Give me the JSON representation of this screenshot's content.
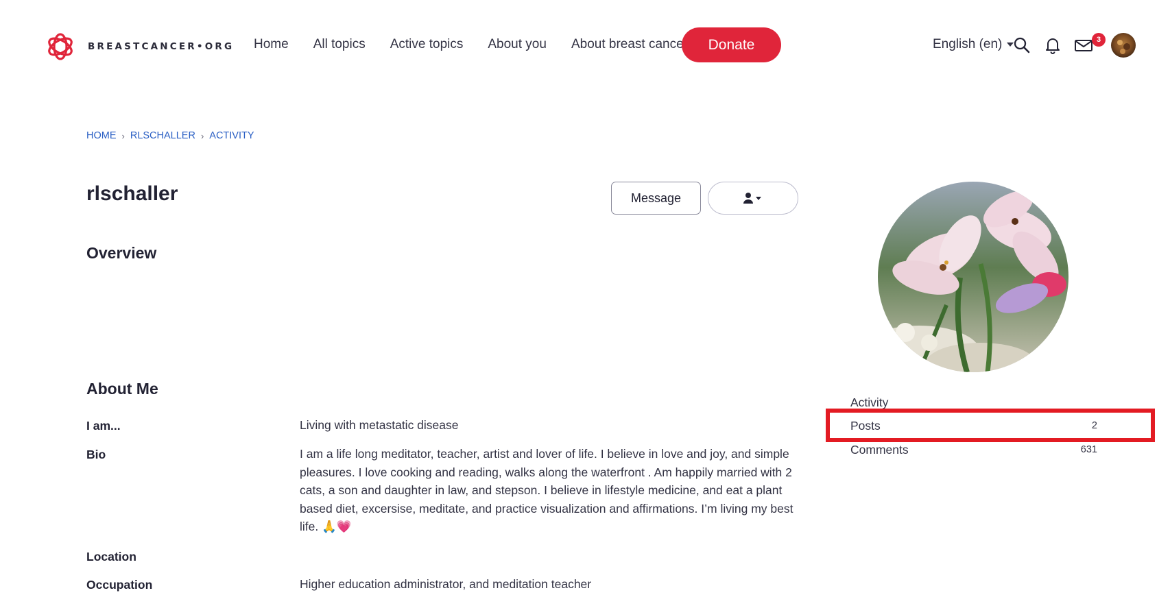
{
  "brand": {
    "name": "BREASTCANCER•ORG"
  },
  "nav": [
    "Home",
    "All topics",
    "Active topics",
    "About you",
    "About breast cancer"
  ],
  "donate_label": "Donate",
  "language": "English (en)",
  "notifications": {
    "messages_badge": "3"
  },
  "breadcrumb": [
    "HOME",
    "RLSCHALLER",
    "ACTIVITY"
  ],
  "profile": {
    "username": "rlschaller",
    "message_button": "Message",
    "overview_title": "Overview",
    "about_title": "About Me",
    "fields": {
      "iam_label": "I am...",
      "iam_value": "Living with metastatic disease",
      "bio_label": "Bio",
      "bio_value": "I am a life long meditator, teacher, artist and lover of life. I believe in love and joy, and simple pleasures. I love cooking and reading, walks along the waterfront . Am happily married with 2 cats, a son and daughter in law, and stepson. I believe in lifestyle medicine, and eat a plant based diet, excersise, meditate, and practice visualization and affirmations. I’m living my best life. 🙏💗",
      "location_label": "Location",
      "location_value": "",
      "occupation_label": "Occupation",
      "occupation_value": "Higher education administrator, and meditation teacher"
    }
  },
  "stats": [
    {
      "label": "Activity",
      "count": ""
    },
    {
      "label": "Posts",
      "count": "2"
    },
    {
      "label": "Comments",
      "count": "631"
    }
  ],
  "colors": {
    "brand_red": "#e0253a",
    "link_blue": "#2a5fc4",
    "highlight_red": "#e31b23"
  }
}
